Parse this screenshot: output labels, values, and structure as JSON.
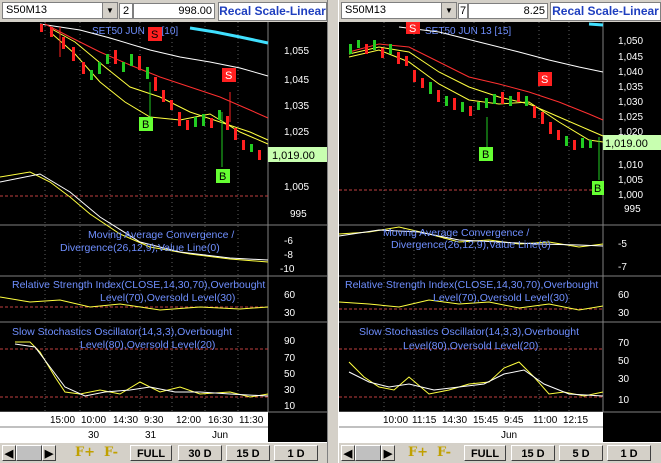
{
  "left": {
    "symbol": "S50M13",
    "clip_num": "2",
    "value": "998.00",
    "scale_button": "Recal Scale-Linear",
    "chart_title": "SET50 JUN 13 [10]",
    "price_axis": [
      "1,055",
      "1,045",
      "1,035",
      "1,025",
      "1,005",
      "995"
    ],
    "price_badge": "1,019.00",
    "macd_title_1": "Moving Average Convergence /",
    "macd_title_2": "Divergence(26,12,9),Value Line(0)",
    "macd_axis": [
      "-6",
      "-8",
      "-10"
    ],
    "rsi_title_1": "Relative Strength Index(CLOSE,14,30,70),Overbought",
    "rsi_title_2": "Level(70),Oversold Level(30)",
    "rsi_axis": [
      "60",
      "30"
    ],
    "sto_title_1": "Slow Stochastics Oscillator(14,3,3),Overbought",
    "sto_title_2": "Level(80),Oversold Level(20)",
    "sto_axis": [
      "90",
      "70",
      "50",
      "30",
      "10"
    ],
    "time_labels": [
      "15:00",
      "10:00",
      "14:30",
      "9:30",
      "12:00",
      "16:30",
      "11:30"
    ],
    "date_labels": [
      "30",
      "31",
      "Jun"
    ],
    "signals": [
      "S",
      "S",
      "B",
      "B"
    ],
    "buttons": [
      "F+",
      "F-",
      "FULL",
      "30 D",
      "15 D",
      "1 D"
    ]
  },
  "right": {
    "symbol": "S50M13",
    "clip_num": "7",
    "value": "8.25",
    "scale_button": "Recal Scale-Linear",
    "chart_title": "SET50 JUN 13 [15]",
    "price_axis": [
      "1,050",
      "1,045",
      "1,040",
      "1,035",
      "1,030",
      "1,025",
      "1,020",
      "1,010",
      "1,005",
      "1,000",
      "995"
    ],
    "price_badge": "1,019.00",
    "macd_title_1": "Moving Average Convergence /",
    "macd_title_2": "Divergence(26,12,9),Value Line(0)",
    "macd_axis": [
      "-5",
      "-7"
    ],
    "rsi_title_1": "Relative Strength Index(CLOSE,14,30,70),Overbought",
    "rsi_title_2": "Level(70),Oversold Level(30)",
    "rsi_axis": [
      "60",
      "30"
    ],
    "sto_title_1": "Slow Stochastics Oscillator(14,3,3),Overbought",
    "sto_title_2": "Level(80),Oversold Level(20)",
    "sto_axis": [
      "70",
      "50",
      "30",
      "10"
    ],
    "time_labels": [
      "10:00",
      "11:15",
      "14:30",
      "15:45",
      "9:45",
      "11:00",
      "12:15"
    ],
    "date_labels": [
      "Jun"
    ],
    "signals": [
      "S",
      "S",
      "B",
      "B"
    ],
    "buttons": [
      "F+",
      "F-",
      "FULL",
      "15 D",
      "5 D",
      "1 D"
    ]
  },
  "colors": {
    "up_candle": "#22cc22",
    "down_candle": "#ff2020",
    "ma_white": "#ffffff",
    "ma_yellow": "#ffff40",
    "ma_red": "#ff2020",
    "ma_cyan": "#40e0ff",
    "indicator_text": "#6f8fff",
    "badge_bg": "#c8ffb0",
    "sell_badge": "#ff2020",
    "buy_badge": "#66ff33"
  }
}
